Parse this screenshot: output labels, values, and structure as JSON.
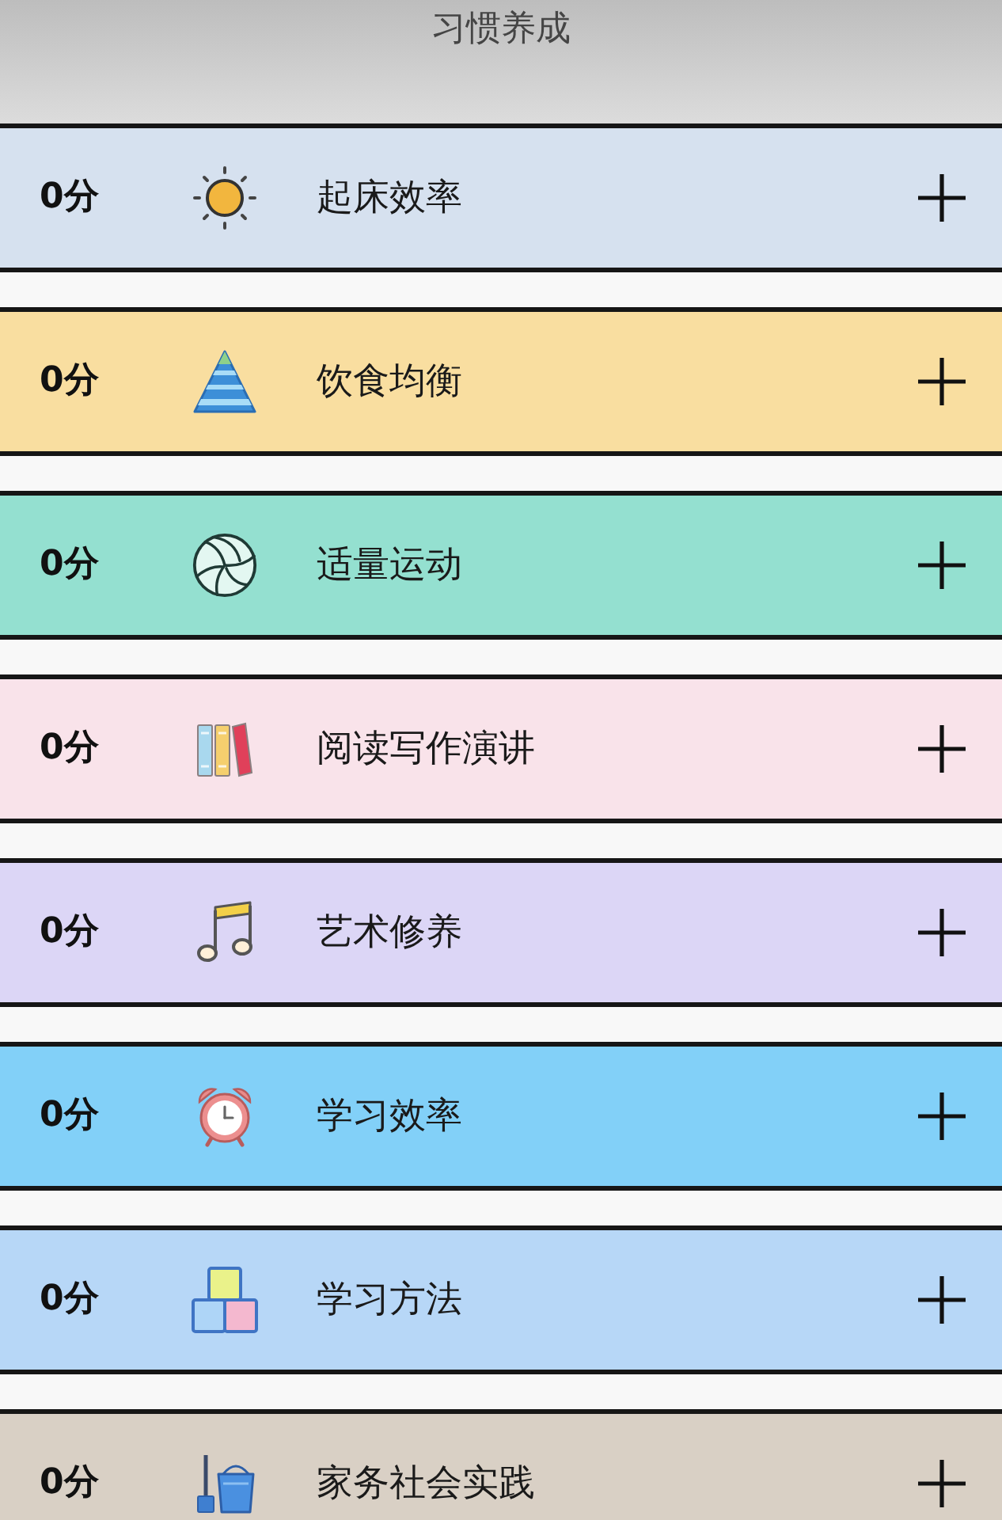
{
  "header": {
    "title": "习惯养成"
  },
  "habits": [
    {
      "score": "0分",
      "name": "起床效率",
      "color": "#d6e1ef"
    },
    {
      "score": "0分",
      "name": "饮食均衡",
      "color": "#f9dea0"
    },
    {
      "score": "0分",
      "name": "适量运动",
      "color": "#94e0d0"
    },
    {
      "score": "0分",
      "name": "阅读写作演讲",
      "color": "#f9e3ea"
    },
    {
      "score": "0分",
      "name": "艺术修养",
      "color": "#dcd6f6"
    },
    {
      "score": "0分",
      "name": "学习效率",
      "color": "#82d0f8"
    },
    {
      "score": "0分",
      "name": "学习方法",
      "color": "#b7d7f7"
    },
    {
      "score": "0分",
      "name": "家务社会实践",
      "color": "#d9d0c5"
    }
  ]
}
